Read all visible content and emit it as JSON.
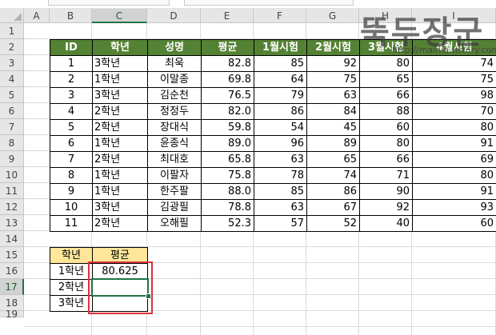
{
  "columns": [
    "A",
    "B",
    "C",
    "D",
    "E",
    "F",
    "G",
    "H",
    "I"
  ],
  "rows": [
    "1",
    "2",
    "3",
    "4",
    "5",
    "6",
    "7",
    "8",
    "9",
    "10",
    "11",
    "12",
    "13",
    "14",
    "15",
    "16",
    "17",
    "18",
    "19"
  ],
  "selected_column": "C",
  "selected_row": "17",
  "table": {
    "headers": [
      "ID",
      "학년",
      "성명",
      "평균",
      "1월시험",
      "2월시험",
      "3월시험",
      "4월시험"
    ],
    "rows": [
      [
        "1",
        "3학년",
        "최욱",
        "82.8",
        "85",
        "92",
        "80",
        "74"
      ],
      [
        "2",
        "1학년",
        "이말종",
        "69.8",
        "64",
        "75",
        "65",
        "75"
      ],
      [
        "3",
        "3학년",
        "김순천",
        "76.5",
        "79",
        "63",
        "66",
        "98"
      ],
      [
        "4",
        "2학년",
        "정정두",
        "82.0",
        "86",
        "84",
        "88",
        "70"
      ],
      [
        "5",
        "2학년",
        "장대식",
        "59.8",
        "54",
        "45",
        "60",
        "80"
      ],
      [
        "6",
        "1학년",
        "윤종식",
        "89.0",
        "96",
        "89",
        "80",
        "91"
      ],
      [
        "7",
        "2학년",
        "최대호",
        "65.8",
        "63",
        "65",
        "66",
        "69"
      ],
      [
        "8",
        "1학년",
        "이팔자",
        "75.8",
        "78",
        "74",
        "71",
        "80"
      ],
      [
        "9",
        "1학년",
        "한주팔",
        "88.0",
        "85",
        "86",
        "90",
        "91"
      ],
      [
        "10",
        "3학년",
        "김광필",
        "78.8",
        "63",
        "67",
        "92",
        "93"
      ],
      [
        "11",
        "2학년",
        "오해필",
        "52.3",
        "57",
        "52",
        "40",
        "60"
      ]
    ]
  },
  "summary": {
    "headers": [
      "학년",
      "평균"
    ],
    "rows": [
      [
        "1학년",
        "80.625"
      ],
      [
        "2학년",
        ""
      ],
      [
        "3학년",
        ""
      ]
    ]
  },
  "watermark": {
    "title": "뚝두장군",
    "url": "http://mainia.tistory.com"
  },
  "colors": {
    "header_green": "#548235",
    "summary_yellow": "#ffe699",
    "selection_green": "#217346",
    "highlight_red": "#e0303a"
  }
}
